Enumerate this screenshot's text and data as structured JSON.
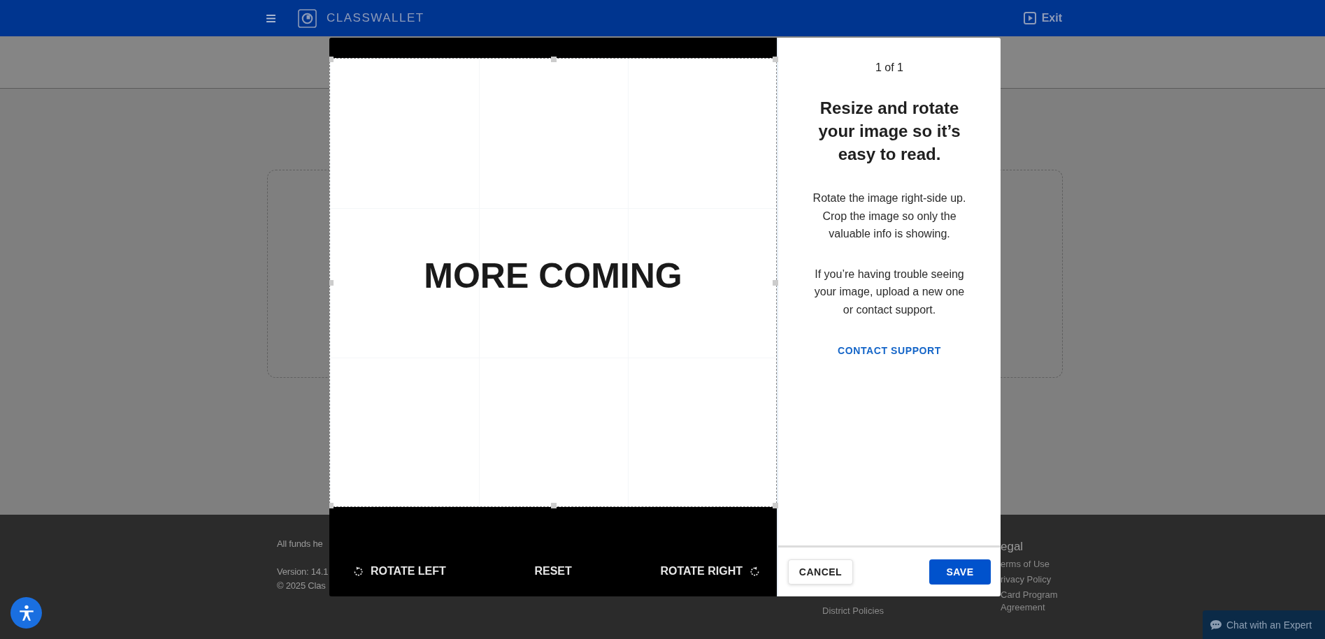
{
  "header": {
    "brand": "CLASSWALLET",
    "exit": "Exit"
  },
  "footer": {
    "notice": "All funds he",
    "version": "Version: 14.1",
    "copyright": "© 2025 Clas",
    "district_policies": "District Policies",
    "legal": {
      "heading": "egal",
      "links": [
        "erms of Use",
        "rivacy Policy",
        "Card Program Agreement"
      ]
    }
  },
  "modal": {
    "image_text": "MORE COMING",
    "tools": [
      {
        "kind": "rotate-left",
        "label": "ROTATE LEFT"
      },
      {
        "kind": "reset",
        "label": "RESET"
      },
      {
        "kind": "rotate-right",
        "label": "ROTATE RIGHT"
      }
    ],
    "counter": "1 of 1",
    "heading": "Resize and rotate your image so it’s easy to read.",
    "paragraphs": [
      "Rotate the image right-side up. Crop the image so only the valuable info is showing.",
      "If you’re having trouble seeing your image, upload a new one or contact support."
    ],
    "link": "CONTACT SUPPORT",
    "cancel": "CANCEL",
    "save": "SAVE"
  },
  "chat": {
    "label": "Chat with an Expert"
  }
}
